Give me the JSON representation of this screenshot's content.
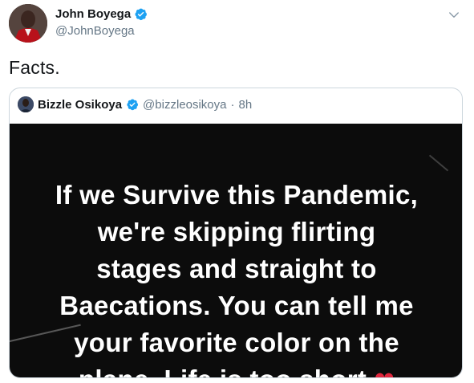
{
  "tweet": {
    "author": {
      "display_name": "John Boyega",
      "handle": "@JohnBoyega",
      "verified": true
    },
    "text": "Facts.",
    "menu_icon": "chevron-down-icon"
  },
  "quoted_tweet": {
    "author": {
      "display_name": "Bizzle Osikoya",
      "handle": "@bizzleosikoya",
      "verified": true
    },
    "separator": "·",
    "time": "8h",
    "media": {
      "background_color": "#0c0c0c",
      "text_lines": [
        "If we Survive this Pandemic,",
        "we're skipping flirting",
        "stages and straight to",
        "Baecations. You can tell me",
        "your favorite color on the",
        "plane. Life is too short"
      ],
      "emoji": "❤"
    }
  },
  "colors": {
    "verified_blue": "#1da1f2",
    "secondary_text": "#657786",
    "border": "#ccd6dd"
  }
}
